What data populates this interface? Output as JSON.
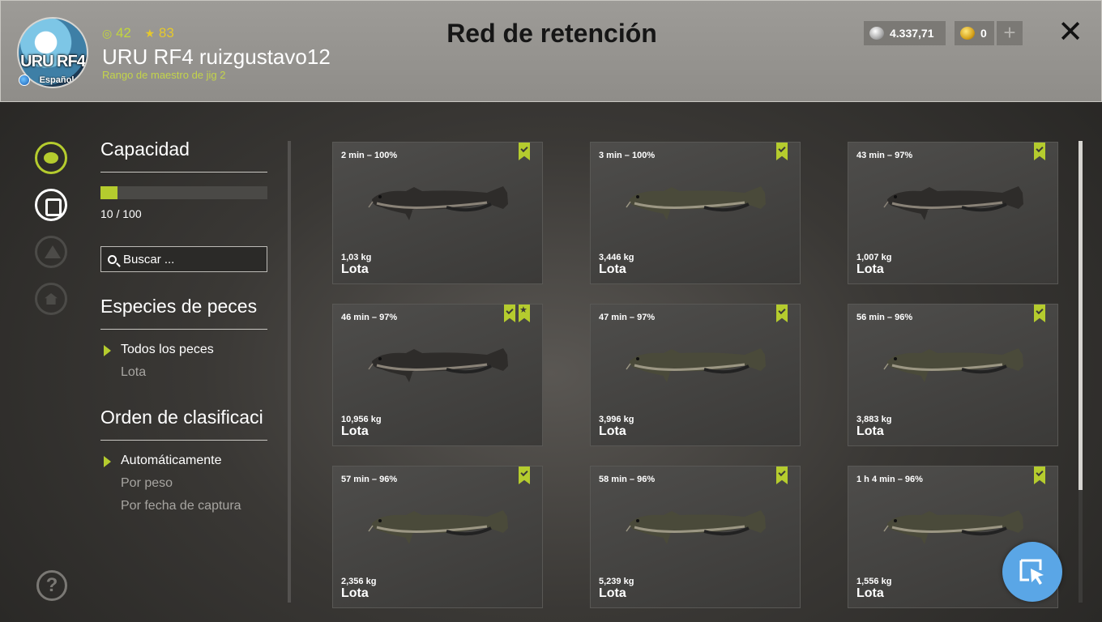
{
  "profile": {
    "avatar_text": "URU RF4",
    "avatar_sub": "Español",
    "level": "42",
    "stars": "83",
    "username": "URU RF4 ruizgustavo12",
    "rank": "Rango de maestro de jig 2"
  },
  "header": {
    "title": "Red de retención",
    "silver": "4.337,71",
    "gold": "0",
    "plus_label": "+",
    "close_label": "✕"
  },
  "filters": {
    "capacity_title": "Capacidad",
    "capacity_text": "10 / 100",
    "capacity_fraction": 0.1,
    "search_placeholder": "Buscar ...",
    "species_title": "Especies de peces",
    "species_options": [
      "Todos los peces",
      "Lota"
    ],
    "sort_title": "Orden de clasificaci",
    "sort_options": [
      "Automáticamente",
      "Por peso",
      "Por fecha de captura"
    ]
  },
  "catches": [
    {
      "time": "2 min – 100%",
      "weight": "1,03 kg",
      "species": "Lota",
      "star": false,
      "shade": "dark"
    },
    {
      "time": "3 min – 100%",
      "weight": "3,446 kg",
      "species": "Lota",
      "star": false,
      "shade": "light"
    },
    {
      "time": "43 min – 97%",
      "weight": "1,007 kg",
      "species": "Lota",
      "star": false,
      "shade": "dark"
    },
    {
      "time": "46 min – 97%",
      "weight": "10,956 kg",
      "species": "Lota",
      "star": true,
      "shade": "dark"
    },
    {
      "time": "47 min – 97%",
      "weight": "3,996 kg",
      "species": "Lota",
      "star": false,
      "shade": "light"
    },
    {
      "time": "56 min – 96%",
      "weight": "3,883 kg",
      "species": "Lota",
      "star": false,
      "shade": "light"
    },
    {
      "time": "57 min – 96%",
      "weight": "2,356 kg",
      "species": "Lota",
      "star": false,
      "shade": "light"
    },
    {
      "time": "58 min – 96%",
      "weight": "5,239 kg",
      "species": "Lota",
      "star": false,
      "shade": "light"
    },
    {
      "time": "1 h 4 min – 96%",
      "weight": "1,556 kg",
      "species": "Lota",
      "star": false,
      "shade": "light"
    }
  ],
  "colors": {
    "accent": "#b5cc2e",
    "gold": "#e5c82c",
    "button_blue": "#5aa6e6"
  }
}
